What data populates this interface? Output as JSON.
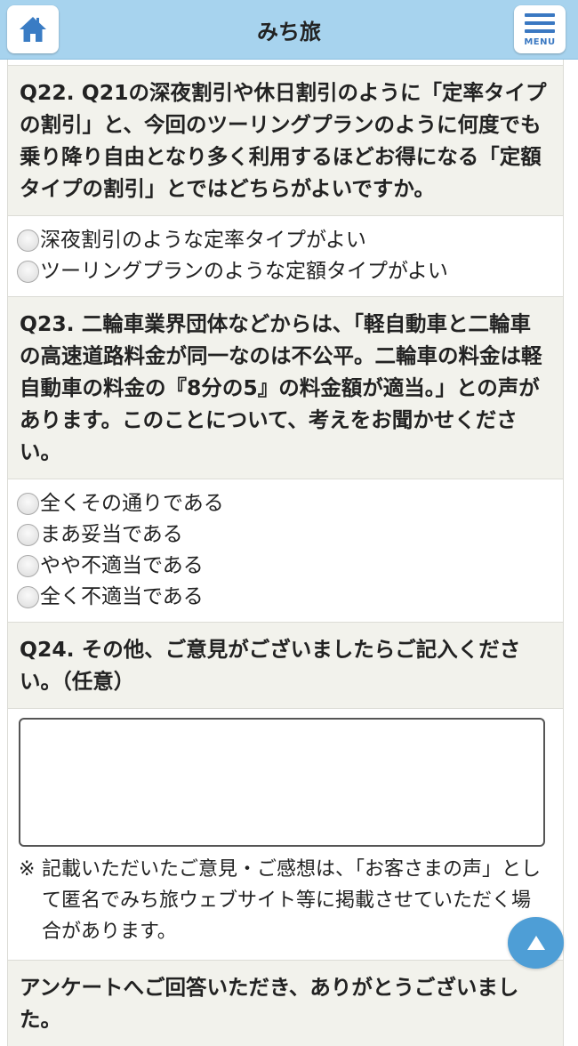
{
  "header": {
    "title": "みち旅",
    "menu_label": "MENU",
    "home_icon": "home-icon",
    "menu_icon": "hamburger-menu-icon"
  },
  "q22": {
    "question": "Q22. Q21の深夜割引や休日割引のように「定率タイプの割引」と、今回のツーリングプランのように何度でも乗り降り自由となり多く利用するほどお得になる「定額タイプの割引」とではどちらがよいですか。",
    "options": [
      "深夜割引のような定率タイプがよい",
      "ツーリングプランのような定額タイプがよい"
    ]
  },
  "q23": {
    "question": "Q23. 二輪車業界団体などからは、「軽自動車と二輪車の高速道路料金が同一なのは不公平。二輪車の料金は軽自動車の料金の『8分の5』の料金額が適当。」との声があります。このことについて、考えをお聞かせください。",
    "options": [
      "全くその通りである",
      "まあ妥当である",
      "やや不適当である",
      "全く不適当である"
    ]
  },
  "q24": {
    "question": "Q24. その他、ご意見がございましたらご記入ください。（任意）",
    "textarea_value": "",
    "note_mark": "※",
    "note": "記載いただいたご意見・ご感想は、「お客さまの声」として匿名でみち旅ウェブサイト等に掲載させていただく場合があります。"
  },
  "thanks": "アンケートへご回答いただき、ありがとうございました。",
  "colors": {
    "header_bg": "#a7d3ee",
    "question_bg": "#f2f2ec",
    "accent": "#4e9ed6",
    "menu_blue": "#3a78c2"
  },
  "back_to_top_icon": "up-triangle-icon"
}
